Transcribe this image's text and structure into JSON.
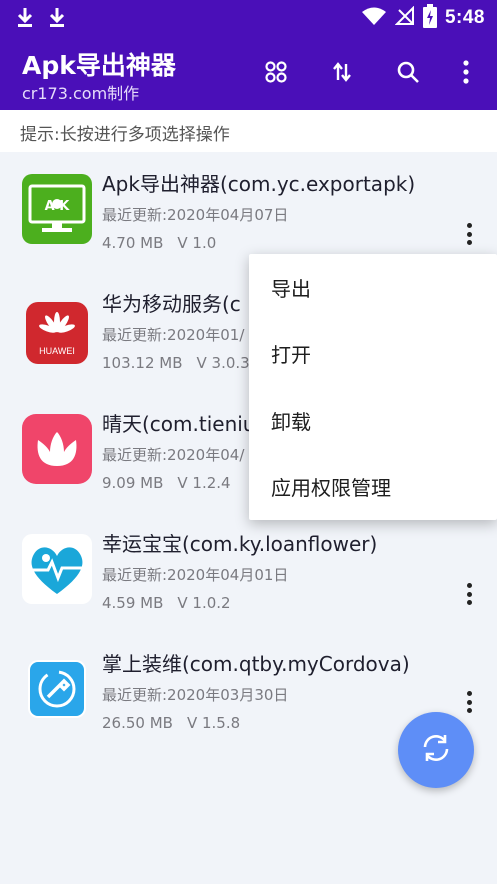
{
  "status_bar": {
    "time": "5:48",
    "left_icons": [
      "download-icon",
      "download-icon"
    ],
    "right_icons": [
      "wifi-icon",
      "no-signal-icon",
      "battery-charging-icon"
    ]
  },
  "app_bar": {
    "title": "Apk导出神器",
    "subtitle": "cr173.com制作",
    "actions": [
      "grid-view-icon",
      "sort-icon",
      "search-icon",
      "overflow-menu-icon"
    ]
  },
  "hint": "提示:长按进行多项选择操作",
  "apps": [
    {
      "name": "Apk导出神器(com.yc.exportapk)",
      "updated": "最近更新:2020年04月07日",
      "size": "4.70 MB",
      "version": "V 1.0",
      "icon": "export-apk-icon",
      "icon_text": "A   K"
    },
    {
      "name": "华为移动服务(c",
      "updated": "最近更新:2020年01/",
      "size": "103.12 MB",
      "version": "V 3.0.3.",
      "icon": "huawei-icon",
      "icon_text": "HUAWEI"
    },
    {
      "name": "晴天(com.tieniu",
      "updated": "最近更新:2020年04/",
      "size": "9.09 MB",
      "version": "V 1.2.4",
      "icon": "lotus-icon"
    },
    {
      "name": "幸运宝宝(com.ky.loanflower)",
      "updated": "最近更新:2020年04月01日",
      "size": "4.59 MB",
      "version": "V 1.0.2",
      "icon": "heart-pulse-icon"
    },
    {
      "name": "掌上装维(com.qtby.myCordova)",
      "updated": "最近更新:2020年03月30日",
      "size": "26.50 MB",
      "version": "V 1.5.8",
      "icon": "wrench-icon"
    }
  ],
  "popup_menu": [
    "导出",
    "打开",
    "卸载",
    "应用权限管理"
  ],
  "fab": {
    "icon": "refresh-icon"
  },
  "colors": {
    "primary": "#4a0fb8",
    "fab": "#5e8ef7",
    "background": "#f1f4f9"
  }
}
